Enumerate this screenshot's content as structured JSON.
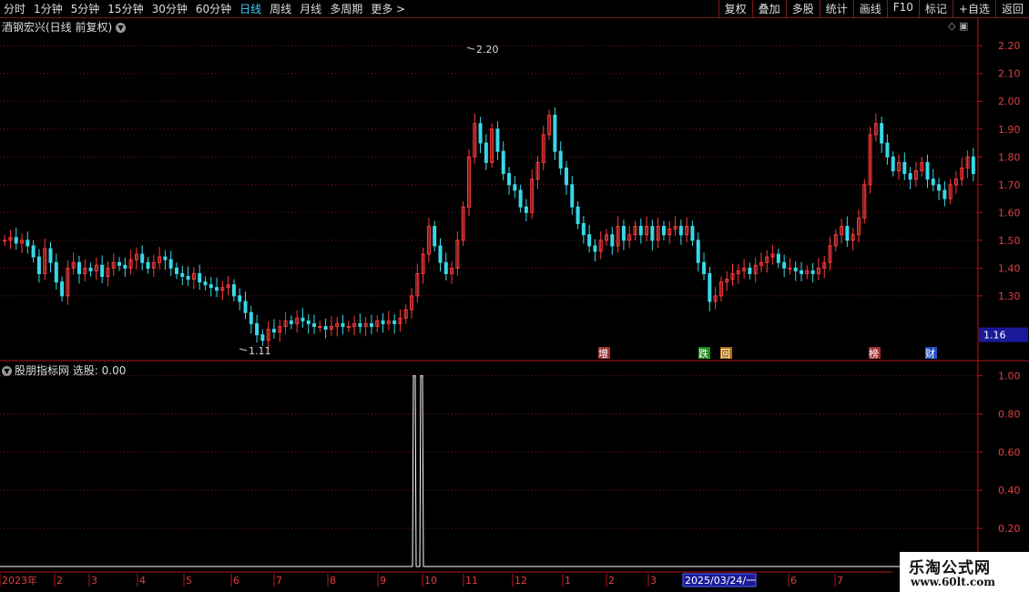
{
  "toolbar": {
    "periods": [
      "分时",
      "1分钟",
      "5分钟",
      "15分钟",
      "30分钟",
      "60分钟",
      "日线",
      "周线",
      "月线",
      "多周期",
      "更多 >"
    ],
    "active_period": "日线",
    "actions": [
      "复权",
      "叠加",
      "多股",
      "统计",
      "画线",
      "F10",
      "标记",
      "+自选",
      "返回"
    ]
  },
  "main_title": "酒钢宏兴(日线 前复权)",
  "indicator_title": "股朋指标网  选股: 0.00",
  "watermark": {
    "line1": "乐淘公式网",
    "line2": "www.60lt.com"
  },
  "colors": {
    "up": "#ff3b3b",
    "down": "#39d7e6",
    "axis": "#b01818",
    "grid": "#7a1a1a"
  },
  "chart_data": [
    {
      "type": "candlestick",
      "title": "酒钢宏兴(日线 前复权)",
      "y_ticks": [
        2.2,
        2.1,
        2.0,
        1.9,
        1.8,
        1.7,
        1.6,
        1.5,
        1.4,
        1.3
      ],
      "ylim": [
        1.08,
        2.24
      ],
      "current_price_label": "1.16",
      "annotations": [
        {
          "text": "2.20",
          "value": 2.2,
          "month": "11"
        },
        {
          "text": "1.11",
          "value": 1.11,
          "month": "6"
        }
      ],
      "event_markers": [
        "增",
        "跌",
        "回",
        "榜",
        "财"
      ],
      "close_series": [
        1.5,
        1.51,
        1.49,
        1.5,
        1.48,
        1.44,
        1.38,
        1.47,
        1.42,
        1.35,
        1.3,
        1.4,
        1.42,
        1.38,
        1.4,
        1.39,
        1.41,
        1.37,
        1.4,
        1.42,
        1.41,
        1.4,
        1.43,
        1.45,
        1.42,
        1.4,
        1.42,
        1.44,
        1.43,
        1.4,
        1.38,
        1.37,
        1.36,
        1.38,
        1.35,
        1.34,
        1.33,
        1.32,
        1.33,
        1.34,
        1.3,
        1.28,
        1.24,
        1.2,
        1.16,
        1.14,
        1.18,
        1.17,
        1.19,
        1.21,
        1.2,
        1.22,
        1.21,
        1.2,
        1.19,
        1.19,
        1.18,
        1.19,
        1.2,
        1.19,
        1.19,
        1.2,
        1.19,
        1.2,
        1.19,
        1.21,
        1.2,
        1.21,
        1.2,
        1.22,
        1.25,
        1.3,
        1.38,
        1.45,
        1.55,
        1.48,
        1.42,
        1.38,
        1.4,
        1.5,
        1.62,
        1.8,
        1.92,
        1.85,
        1.78,
        1.9,
        1.82,
        1.74,
        1.7,
        1.68,
        1.62,
        1.6,
        1.72,
        1.78,
        1.88,
        1.95,
        1.82,
        1.76,
        1.7,
        1.62,
        1.56,
        1.52,
        1.48,
        1.46,
        1.5,
        1.52,
        1.48,
        1.55,
        1.5,
        1.52,
        1.55,
        1.52,
        1.55,
        1.5,
        1.55,
        1.52,
        1.54,
        1.55,
        1.52,
        1.55,
        1.5,
        1.42,
        1.38,
        1.28,
        1.3,
        1.35,
        1.36,
        1.38,
        1.39,
        1.4,
        1.38,
        1.41,
        1.42,
        1.44,
        1.45,
        1.42,
        1.4,
        1.4,
        1.39,
        1.38,
        1.39,
        1.38,
        1.4,
        1.42,
        1.48,
        1.52,
        1.55,
        1.5,
        1.52,
        1.58,
        1.7,
        1.88,
        1.92,
        1.85,
        1.8,
        1.75,
        1.78,
        1.74,
        1.72,
        1.75,
        1.78,
        1.72,
        1.7,
        1.68,
        1.65,
        1.7,
        1.72,
        1.76,
        1.8,
        1.74
      ]
    },
    {
      "type": "line",
      "title": "股朋指标网",
      "series": [
        {
          "name": "选股",
          "last_value": 0.0
        }
      ],
      "y_ticks": [
        1.0,
        0.8,
        0.6,
        0.4,
        0.2
      ],
      "ylim": [
        0,
        1.06
      ],
      "signals": [
        {
          "month": "9",
          "value": 1
        },
        {
          "month": "10",
          "value": 1
        }
      ]
    }
  ],
  "x_axis": {
    "labels": [
      "2023年",
      "2",
      "3",
      "4",
      "5",
      "6",
      "7",
      "8",
      "9",
      "10",
      "11",
      "12",
      "1",
      "2",
      "3",
      "2025/03/24/一",
      "6",
      "7"
    ],
    "highlight": "2025/03/24/一"
  }
}
